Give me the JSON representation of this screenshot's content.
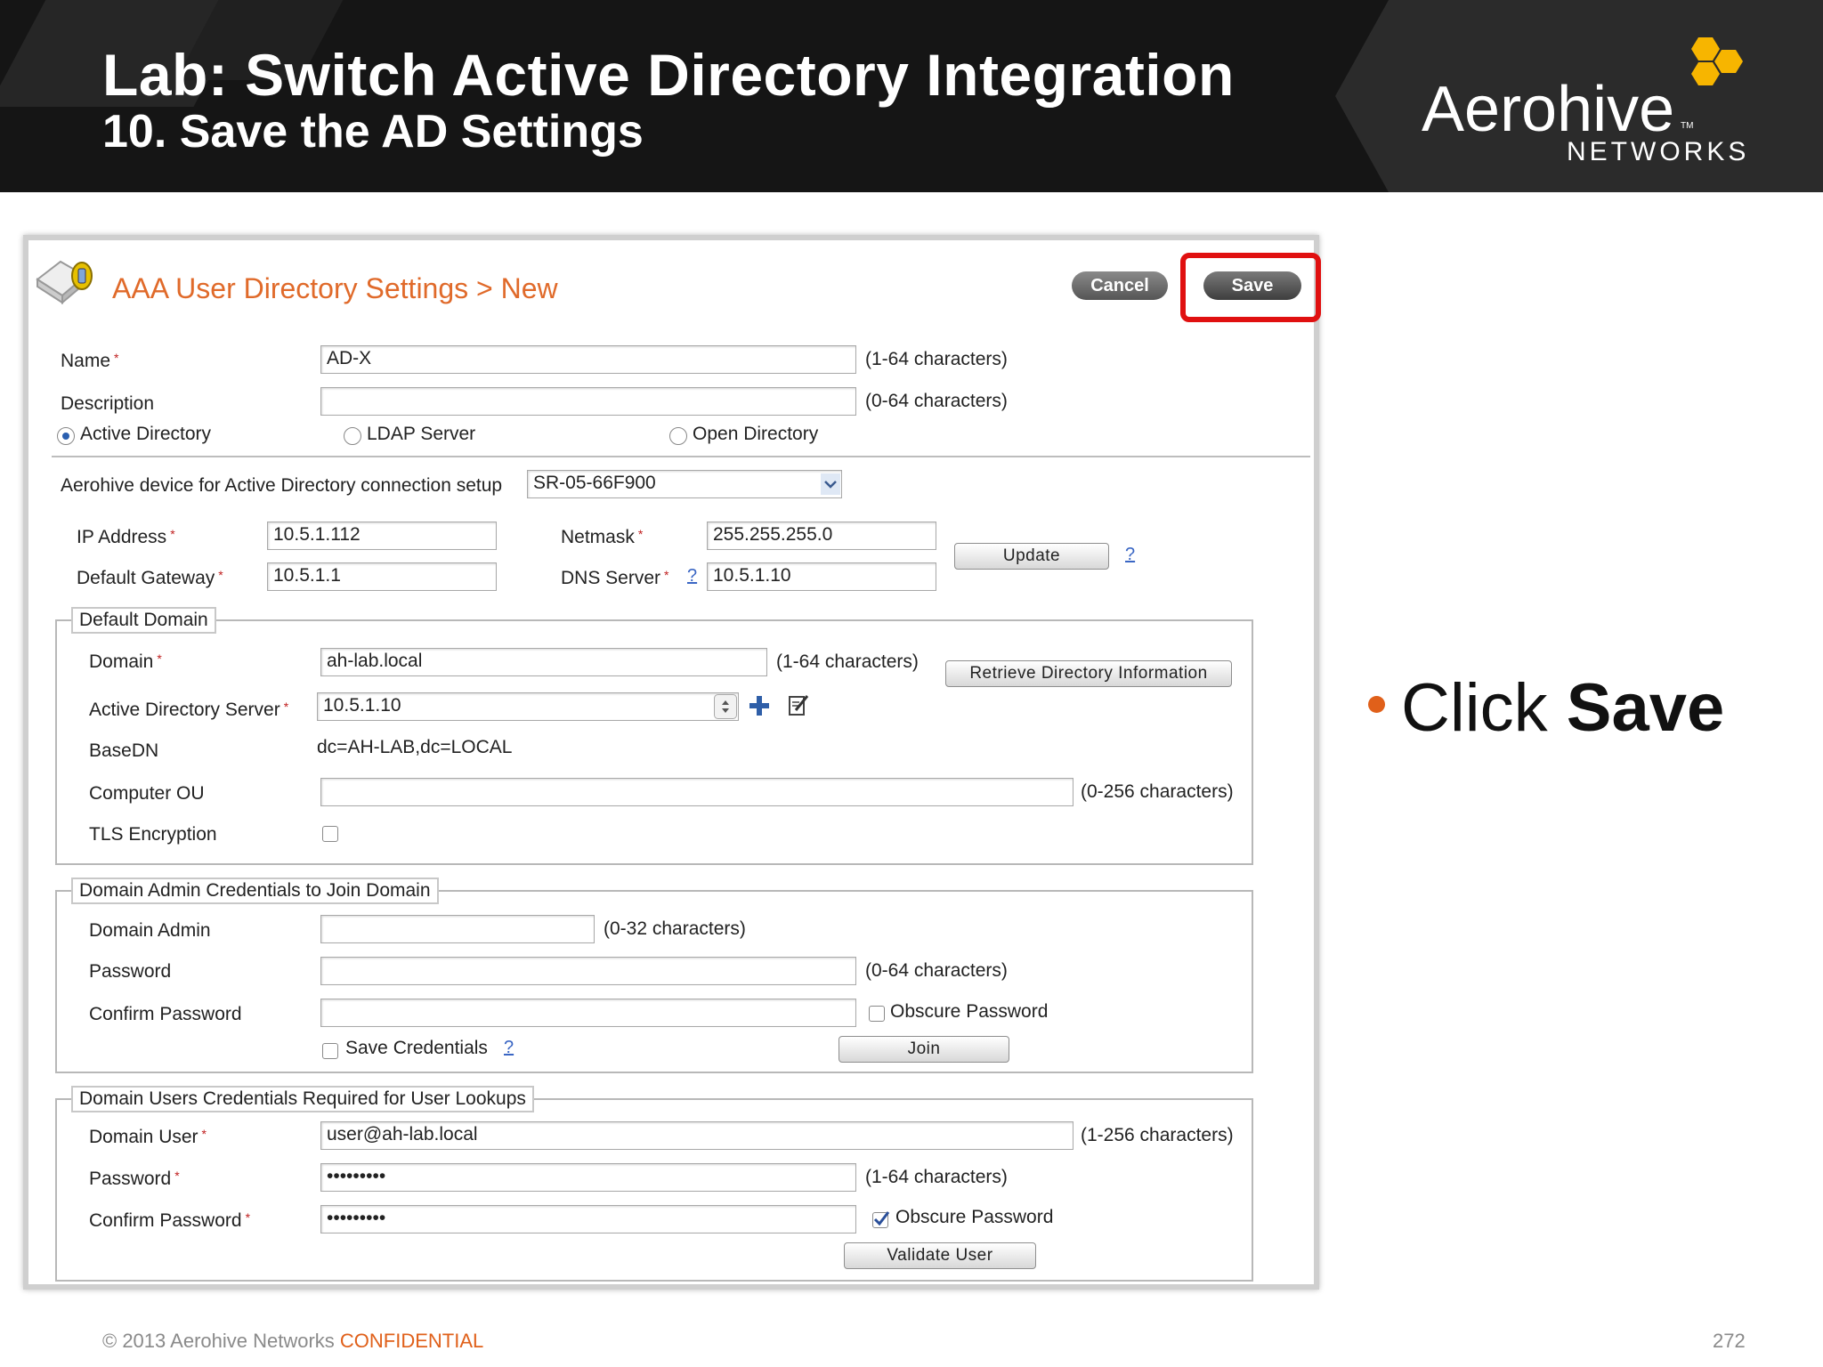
{
  "slide": {
    "title": "Lab: Switch Active Directory Integration",
    "subtitle": "10. Save the AD Settings",
    "brand": "Aerohive",
    "brand_tm": "TM",
    "brand_sub": "NETWORKS"
  },
  "colors": {
    "header_bg": "#151515",
    "accent_orange": "#e0601a",
    "logo_yellow": "#f7b500",
    "title_orange": "#e06a2a",
    "highlight_red": "#e01010"
  },
  "panel": {
    "title": "AAA User Directory Settings > New",
    "cancel_label": "Cancel",
    "save_label": "Save",
    "name_label": "Name",
    "name_value": "AD-X",
    "name_hint": "(1-64 characters)",
    "description_label": "Description",
    "description_value": "",
    "description_hint": "(0-64 characters)",
    "type_options": [
      "Active Directory",
      "LDAP Server",
      "Open Directory"
    ],
    "type_selected": "Active Directory",
    "device_label": "Aerohive device for Active Directory connection setup",
    "device_value": "SR-05-66F900",
    "ip_label": "IP Address",
    "ip_value": "10.5.1.112",
    "gateway_label": "Default Gateway",
    "gateway_value": "10.5.1.1",
    "netmask_label": "Netmask",
    "netmask_value": "255.255.255.0",
    "dns_label": "DNS Server",
    "dns_value": "10.5.1.10",
    "update_label": "Update",
    "help_mark": "?",
    "required_mark": "*"
  },
  "default_domain": {
    "legend": "Default Domain",
    "domain_label": "Domain",
    "domain_value": "ah-lab.local",
    "domain_hint": "(1-64 characters)",
    "retrieve_label": "Retrieve Directory Information",
    "ad_server_label": "Active Directory Server",
    "ad_server_value": "10.5.1.10",
    "basedn_label": "BaseDN",
    "basedn_value": "dc=AH-LAB,dc=LOCAL",
    "ou_label": "Computer OU",
    "ou_value": "",
    "ou_hint": "(0-256 characters)",
    "tls_label": "TLS Encryption",
    "tls_checked": false
  },
  "admin_creds": {
    "legend": "Domain Admin Credentials to Join Domain",
    "admin_label": "Domain Admin",
    "admin_value": "",
    "admin_hint": "(0-32 characters)",
    "password_label": "Password",
    "password_value": "",
    "password_hint": "(0-64 characters)",
    "confirm_label": "Confirm Password",
    "confirm_value": "",
    "obscure_label": "Obscure Password",
    "obscure_checked": false,
    "save_creds_label": "Save Credentials",
    "save_creds_checked": false,
    "join_label": "Join"
  },
  "user_creds": {
    "legend": "Domain Users Credentials Required for User Lookups",
    "user_label": "Domain User",
    "user_value": "user@ah-lab.local",
    "user_hint": "(1-256 characters)",
    "password_label": "Password",
    "password_value": "•••••••••",
    "password_hint": "(1-64 characters)",
    "confirm_label": "Confirm Password",
    "confirm_value": "•••••••••",
    "obscure_label": "Obscure Password",
    "obscure_checked": true,
    "validate_label": "Validate User"
  },
  "bullet": {
    "prefix": "Click ",
    "emphasis": "Save"
  },
  "footer": {
    "copyright": "© 2013 Aerohive Networks ",
    "confidential": "CONFIDENTIAL",
    "page": "272"
  },
  "icons": [
    "directory-settings-icon",
    "add-plus-icon",
    "edit-icon",
    "dropdown-chevron-icon",
    "spinner-arrows-icon",
    "checkmark-icon",
    "aerohive-logo-icon"
  ]
}
